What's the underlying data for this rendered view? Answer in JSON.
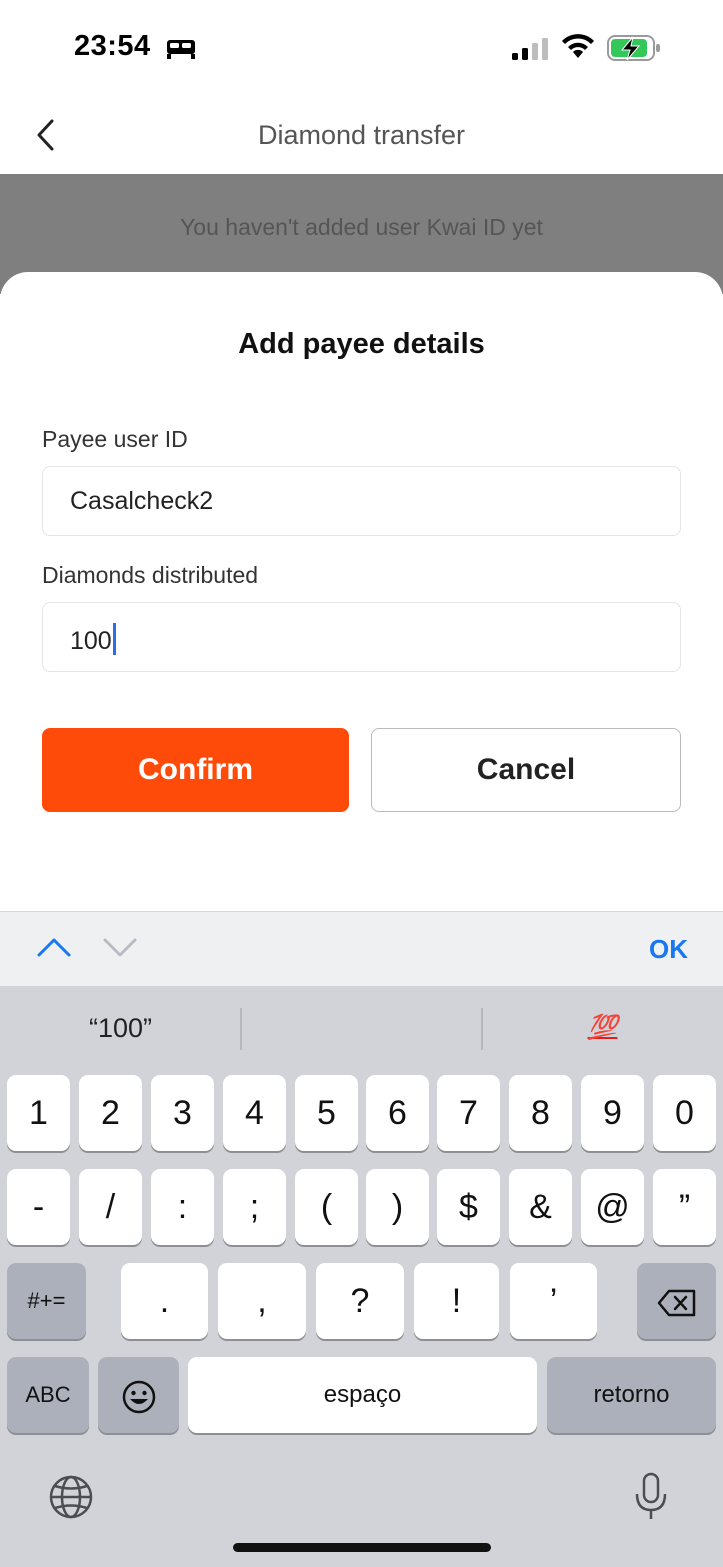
{
  "status_bar": {
    "time": "23:54",
    "icons": [
      "bed-icon",
      "signal-icon",
      "wifi-icon",
      "battery-charging-icon"
    ]
  },
  "nav": {
    "title": "Diamond transfer",
    "back_icon": "chevron-left-icon"
  },
  "background": {
    "message": "You haven't added user Kwai ID yet"
  },
  "sheet": {
    "title": "Add payee details",
    "payee_label": "Payee user ID",
    "payee_value": "Casalcheck2",
    "diamonds_label": "Diamonds distributed",
    "diamonds_value": "100",
    "confirm_label": "Confirm",
    "cancel_label": "Cancel"
  },
  "accessory": {
    "ok_label": "OK"
  },
  "keyboard": {
    "predictions": [
      "“100”",
      "",
      "💯"
    ],
    "row1": [
      "1",
      "2",
      "3",
      "4",
      "5",
      "6",
      "7",
      "8",
      "9",
      "0"
    ],
    "row2": [
      "-",
      "/",
      ":",
      ";",
      "(",
      ")",
      "$",
      "&",
      "@",
      "”"
    ],
    "row3": [
      ".",
      ",",
      "?",
      "!",
      "’"
    ],
    "shift_label": "#+=",
    "abc_label": "ABC",
    "space_label": "espaço",
    "return_label": "retorno"
  },
  "colors": {
    "accent": "#ff4b0a",
    "ok_blue": "#1877f2",
    "caret": "#2f6bf0"
  }
}
